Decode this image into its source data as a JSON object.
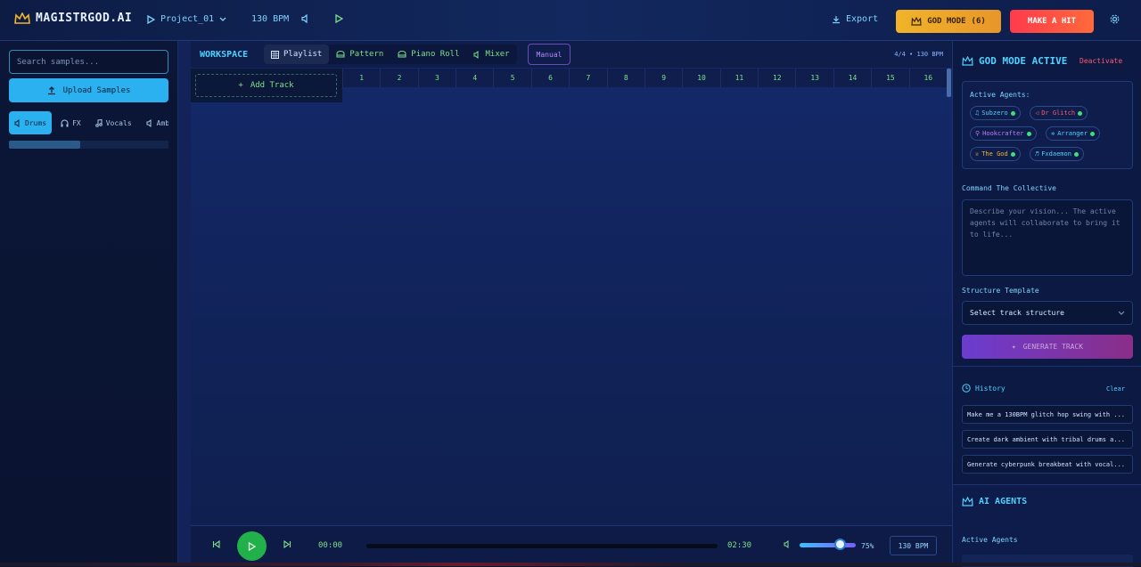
{
  "header": {
    "app_title": "MAGISTRGOD.AI",
    "project": "Project_01",
    "bpm": "130 BPM",
    "export_label": "Export",
    "god_mode_label": "GOD MODE",
    "god_mode_count": "(6)",
    "make_hit_label": "MAKE A HIT"
  },
  "sidebar": {
    "search_placeholder": "Search samples...",
    "upload_label": "Upload Samples",
    "categories": [
      {
        "label": "Drums",
        "icon": "speaker-icon",
        "active": true
      },
      {
        "label": "FX",
        "icon": "headphones-icon"
      },
      {
        "label": "Vocals",
        "icon": "music-note-icon"
      },
      {
        "label": "Amb",
        "icon": "speaker-icon"
      }
    ]
  },
  "workspace": {
    "title": "WORKSPACE",
    "tabs": [
      {
        "label": "Playlist",
        "icon": "grid-icon",
        "active": true
      },
      {
        "label": "Pattern",
        "icon": "piano-icon"
      },
      {
        "label": "Piano Roll",
        "icon": "piano-icon"
      },
      {
        "label": "Mixer",
        "icon": "speaker-icon"
      }
    ],
    "manual_label": "Manual",
    "meta": "4/4 • 130 BPM",
    "add_track_label": "Add Track",
    "bars": [
      "1",
      "2",
      "3",
      "4",
      "5",
      "6",
      "7",
      "8",
      "9",
      "10",
      "11",
      "12",
      "13",
      "14",
      "15",
      "16"
    ]
  },
  "transport": {
    "time_current": "00:00",
    "time_total": "02:30",
    "volume": "75%",
    "bpm": "130 BPM",
    "progress": 0,
    "volume_level": 0.75
  },
  "god_panel": {
    "title": "GOD MODE ACTIVE",
    "deactivate_label": "Deactivate",
    "active_agents_label": "Active Agents:",
    "agents": [
      {
        "name": "Subzero",
        "color": "#4fd2ff",
        "icon": "music-note-icon"
      },
      {
        "name": "Dr Glitch",
        "color": "#ff5a6a",
        "icon": "speaker-icon"
      },
      {
        "name": "Hookcrafter",
        "color": "#c07bff",
        "icon": "mic-icon"
      },
      {
        "name": "Arranger",
        "color": "#4fd2ff",
        "icon": "gear-icon"
      },
      {
        "name": "The God",
        "color": "#f0b429",
        "icon": "crown-icon"
      },
      {
        "name": "Fxdaemon",
        "color": "#4fd2ff",
        "icon": "headphones-icon"
      }
    ],
    "command_label": "Command The Collective",
    "command_placeholder": "Describe your vision... The active agents will collaborate to bring it to life...",
    "structure_label": "Structure Template",
    "structure_value": "Select track structure",
    "generate_label": "GENERATE TRACK",
    "history_label": "History",
    "clear_label": "Clear",
    "history": [
      "Make me a 130BPM glitch hop swing with ...",
      "Create dark ambient with tribal drums a...",
      "Generate cyberpunk breakbeat with vocal..."
    ],
    "ai_agents_title": "AI AGENTS",
    "ai_active_label": "Active Agents"
  },
  "colors": {
    "accent": "#4fd2ff",
    "green": "#7ee08a",
    "gold": "#f0b429",
    "red": "#ff3a4d"
  }
}
